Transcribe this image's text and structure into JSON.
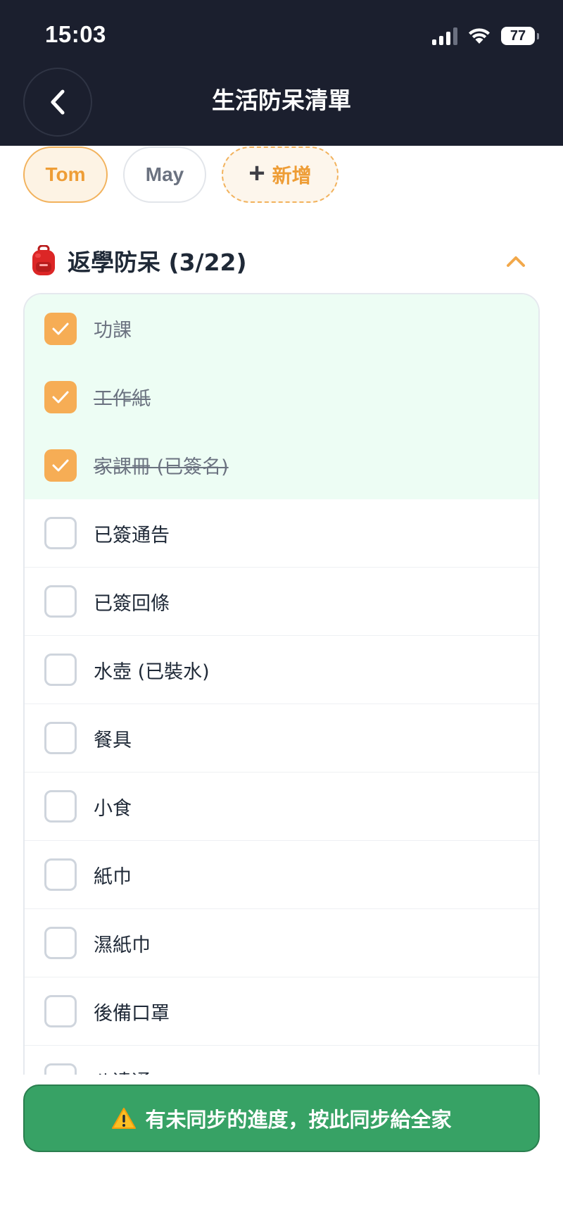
{
  "status_bar": {
    "time": "15:03",
    "battery": "77"
  },
  "header": {
    "title": "生活防呆清單"
  },
  "profiles": [
    {
      "label": "Tom",
      "selected": true
    },
    {
      "label": "May",
      "selected": false
    }
  ],
  "add_profile_label": "新增",
  "section": {
    "title": "返學防呆 (3/22)",
    "icon": "backpack-icon",
    "expanded": true
  },
  "items": [
    {
      "label": "功課",
      "checked": true
    },
    {
      "label": "工作紙",
      "checked": true
    },
    {
      "label": "家課冊 (已簽名)",
      "checked": true
    },
    {
      "label": "已簽通告",
      "checked": false
    },
    {
      "label": "已簽回條",
      "checked": false
    },
    {
      "label": "水壺 (已裝水)",
      "checked": false
    },
    {
      "label": "餐具",
      "checked": false
    },
    {
      "label": "小食",
      "checked": false
    },
    {
      "label": "紙巾",
      "checked": false
    },
    {
      "label": "濕紙巾",
      "checked": false
    },
    {
      "label": "後備口罩",
      "checked": false
    },
    {
      "label": "八達通",
      "checked": false
    }
  ],
  "sync_banner": {
    "label": "有未同步的進度，按此同步給全家",
    "icon": "warning-icon"
  },
  "colors": {
    "header_bg": "#1b1f2e",
    "accent_orange": "#f6ad55",
    "done_row_bg": "#edfdf4",
    "sync_green": "#37a265"
  }
}
